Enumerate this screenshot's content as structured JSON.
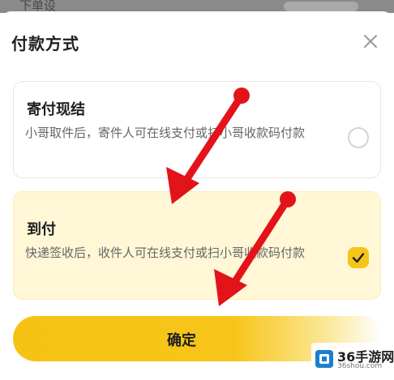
{
  "background_page": {
    "partial_text": "下单设"
  },
  "sheet": {
    "title": "付款方式",
    "close_icon": "close-icon"
  },
  "options": [
    {
      "title": "寄付现结",
      "description": "小哥取件后，寄件人可在线支付或扫小哥收款码付款",
      "selected": false
    },
    {
      "title": "到付",
      "description": "快递签收后，收件人可在线支付或扫小哥收款码付款",
      "selected": true
    }
  ],
  "confirm_button": {
    "label": "确定"
  },
  "colors": {
    "accent": "#f6c313",
    "selected_card_bg": "#fff7d6",
    "annotation_arrow": "#e3131a"
  },
  "watermark": {
    "text": "36手游网",
    "url": "36shou.com"
  }
}
